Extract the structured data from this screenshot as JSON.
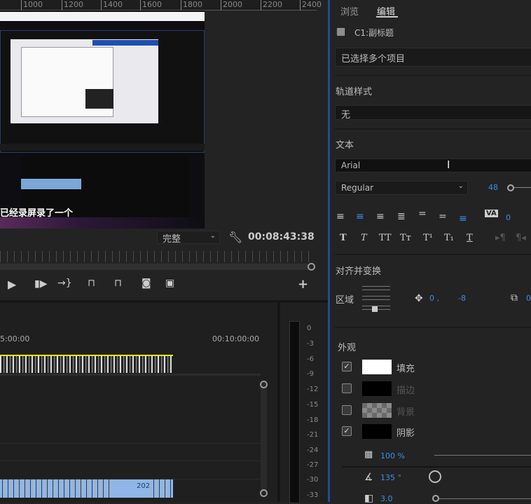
{
  "canvas_ruler": {
    "ticks": [
      "1000",
      "1200",
      "1400",
      "1600",
      "1800",
      "2000",
      "2200",
      "2400"
    ]
  },
  "program_monitor": {
    "subtitle_text": "已经录屏录了一个",
    "resolution_select": "完整",
    "timecode": "00:08:43:38",
    "transport": [
      "play-icon",
      "step-forward-icon",
      "insert-icon",
      "lift-icon",
      "extract-icon",
      "camera-icon",
      "compare-icon",
      "add-icon"
    ]
  },
  "timeline": {
    "time_labels": [
      "5:00:00",
      "00:10:00:00"
    ],
    "clip_label": "202",
    "meter_scale": [
      "0",
      "-3",
      "-6",
      "-9",
      "-12",
      "-15",
      "-18",
      "-21",
      "-24",
      "-27",
      "-30",
      "-33"
    ]
  },
  "essential_graphics": {
    "tabs": [
      {
        "label": "浏览",
        "active": false
      },
      {
        "label": "编辑",
        "active": true
      }
    ],
    "clip_name": "C1:副标题",
    "selection_field": "已选择多个项目",
    "track_style": {
      "heading": "轨道样式",
      "value": "无"
    },
    "text": {
      "heading": "文本",
      "font": "Arial",
      "style": "Regular",
      "size": "48",
      "tracking": "0"
    },
    "align_transform": {
      "heading": "对齐并变换",
      "region_label": "区域",
      "pos_x": "0 ,",
      "pos_y": "-8",
      "scale": "0"
    },
    "appearance": {
      "heading": "外观",
      "items": [
        {
          "label": "填充",
          "checked": true,
          "color": "#ffffff"
        },
        {
          "label": "描边",
          "checked": false,
          "color": "#000000"
        },
        {
          "label": "背景",
          "checked": false,
          "color": "checker"
        },
        {
          "label": "阴影",
          "checked": true,
          "color": "#000000"
        }
      ],
      "shadow_opacity": "100 %",
      "shadow_angle": "135 °",
      "shadow_distance": "3.0"
    }
  },
  "colors": {
    "accent": "#3b8ee8",
    "work_area": "#e6e600",
    "clip": "#8fb6e6"
  }
}
